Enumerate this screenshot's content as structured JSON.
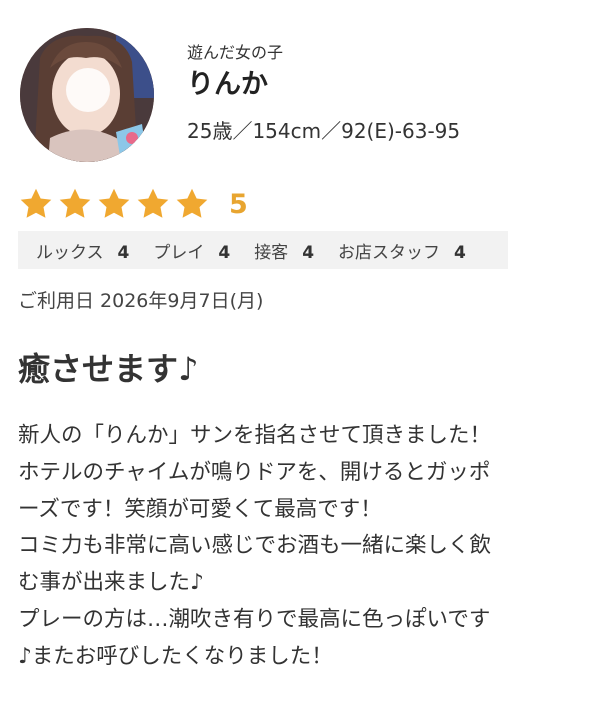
{
  "profile": {
    "label": "遊んだ女の子",
    "name": "りんか",
    "specs": "25歳／154cm／92(E)-63-95",
    "avatar_icon": "profile-photo"
  },
  "rating": {
    "stars": 5,
    "max_stars": 5,
    "score": "5",
    "star_color": "#f0a830"
  },
  "subscores": [
    {
      "label": "ルックス",
      "value": "4"
    },
    {
      "label": "プレイ",
      "value": "4"
    },
    {
      "label": "接客",
      "value": "4"
    },
    {
      "label": "お店スタッフ",
      "value": "4"
    }
  ],
  "date_line": "ご利用日 2026年9月7日(月)",
  "review_title": "癒させます♪",
  "review_body": [
    "新人の「りんか」サンを指名させて頂きました！",
    "ホテルのチャイムが鳴りドアを、開けるとガッポ",
    "ーズです！笑顔が可愛くて最高です！",
    "コミ力も非常に高い感じでお酒も一緒に楽しく飲",
    "む事が出来ました♪",
    "プレーの方は…潮吹き有りで最高に色っぽいです",
    "♪またお呼びしたくなりました！"
  ]
}
